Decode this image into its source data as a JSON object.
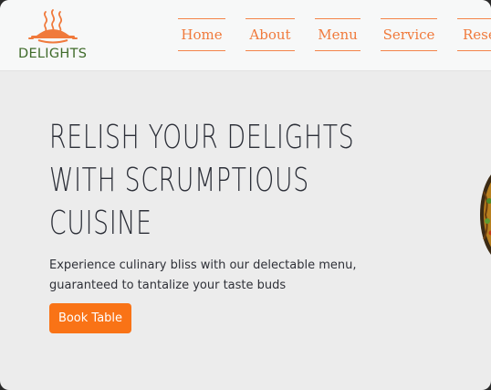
{
  "brand": {
    "name": "DELIGHTS",
    "logo_icon": "steaming-dish-icon",
    "accent": "#f07a3c",
    "text_green": "#3f6b2a"
  },
  "nav": {
    "items": [
      {
        "label": "Home"
      },
      {
        "label": "About"
      },
      {
        "label": "Menu"
      },
      {
        "label": "Service"
      },
      {
        "label": "Rese"
      }
    ]
  },
  "hero": {
    "title_lines": [
      "Relish your delights",
      "with scrumptious",
      "cuisine"
    ],
    "description_lines": [
      "Experience culinary bliss with our delectable menu,",
      "guaranteed to tantalize your taste buds"
    ],
    "button_label": "Book Table",
    "button_color": "#f97316",
    "image_icon": "food-dish-image"
  }
}
